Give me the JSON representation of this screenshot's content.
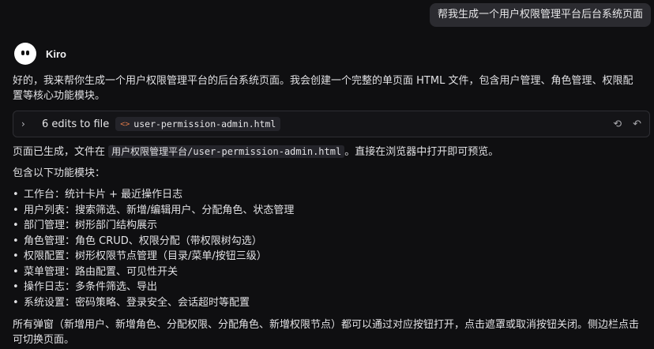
{
  "user_message": "帮我生成一个用户权限管理平台后台系统页面",
  "assistant": {
    "name": "Kiro",
    "intro": "好的，我来帮你生成一个用户权限管理平台的后台系统页面。我会创建一个完整的单页面 HTML 文件，包含用户管理、角色管理、权限配置等核心功能模块。",
    "edits_card": {
      "label": "6 edits to file",
      "file_name": "user-permission-admin.html",
      "icons": [
        "review-icon",
        "undo-icon"
      ]
    },
    "generated_prefix": "页面已生成，文件在 ",
    "generated_path": "用户权限管理平台/user-permission-admin.html",
    "generated_suffix": "。直接在浏览器中打开即可预览。",
    "modules_heading": "包含以下功能模块：",
    "modules": [
      "工作台：统计卡片 + 最近操作日志",
      "用户列表：搜索筛选、新增/编辑用户、分配角色、状态管理",
      "部门管理：树形部门结构展示",
      "角色管理：角色 CRUD、权限分配（带权限树勾选）",
      "权限配置：树形权限节点管理（目录/菜单/按钮三级）",
      "菜单管理：路由配置、可见性开关",
      "操作日志：多条件筛选、导出",
      "系统设置：密码策略、登录安全、会话超时等配置"
    ],
    "closing": "所有弹窗（新增用户、新增角色、分配权限、分配角色、新增权限节点）都可以通过对应按钮打开，点击遮罩或取消按钮关闭。侧边栏点击可切换页面。"
  }
}
